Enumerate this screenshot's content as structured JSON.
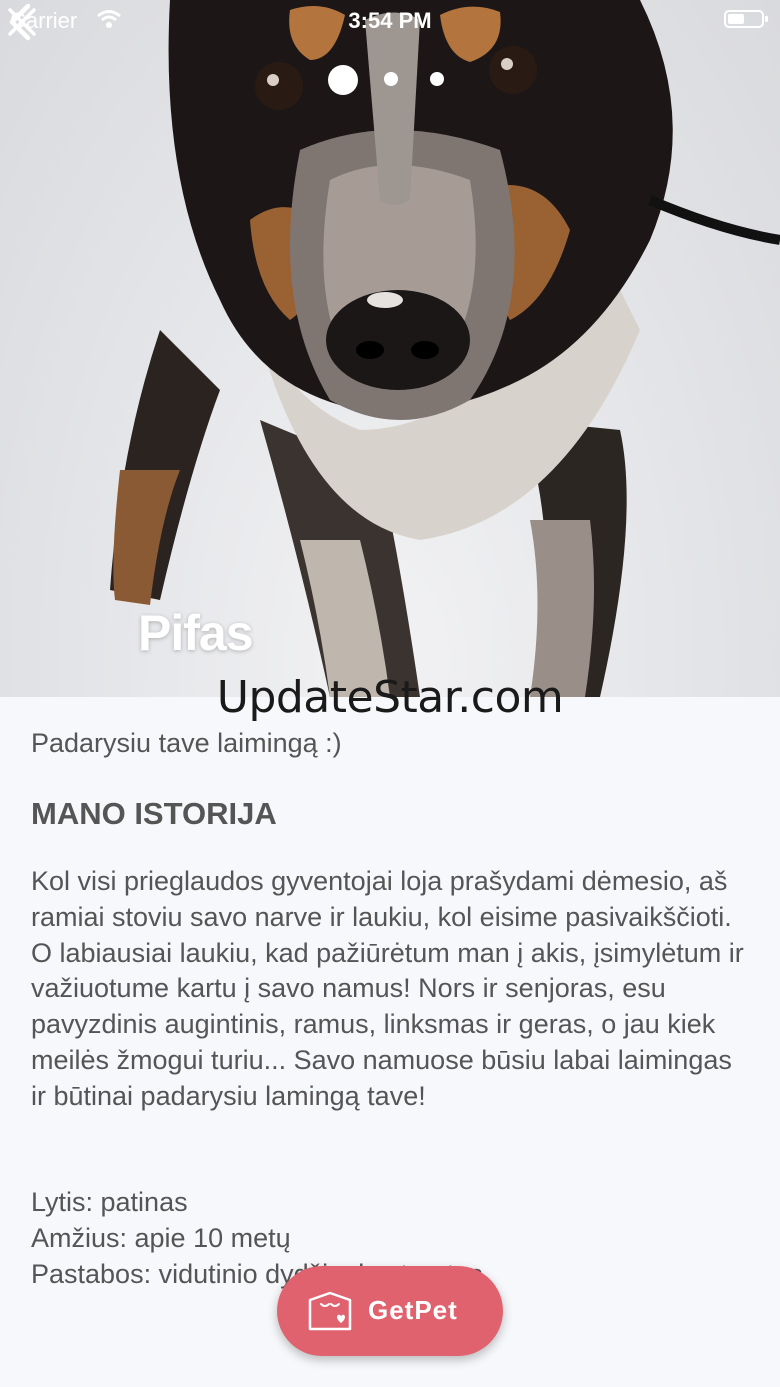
{
  "status_bar": {
    "carrier": "Carrier",
    "time": "3:54 PM"
  },
  "gallery": {
    "page_count": 3,
    "current_page": 1
  },
  "pet": {
    "name": "Pifas",
    "tagline": "Padarysiu tave laimingą :)"
  },
  "watermark": "UpdateStar.com",
  "story": {
    "heading": "MANO ISTORIJA",
    "text": "Kol visi prieglaudos gyventojai loja prašydami dėmesio, aš ramiai stoviu savo narve ir laukiu, kol eisime pasivaikščioti. O labiausiai laukiu, kad pažiūrėtum man į akis, įsimylėtum ir važiuotume kartu į savo namus! Nors ir senjoras,  esu pavyzdinis augintinis, ramus, linksmas ir geras, o jau kiek meilės žmogui turiu... Savo namuose būsiu labai laimingas ir būtinai padarysiu lamingą tave!"
  },
  "facts": {
    "sex": "Lytis: patinas",
    "age": "Amžius: apie 10 metų",
    "notes": "Pastabos: vidutinio dydžio, kastruotas"
  },
  "action": {
    "label": "GetPet",
    "color": "#e0626f"
  }
}
